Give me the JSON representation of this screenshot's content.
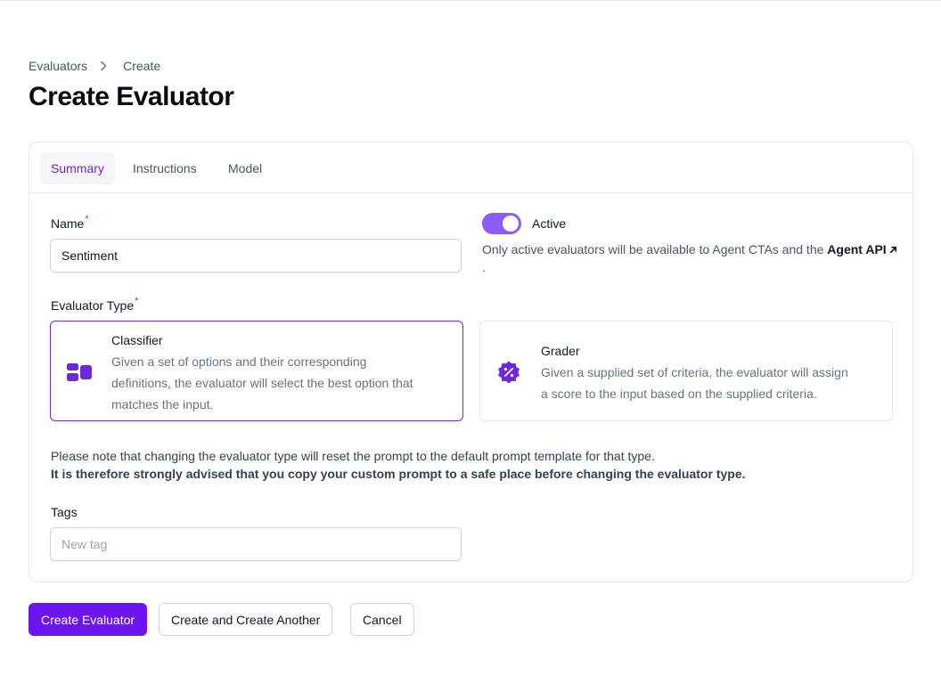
{
  "breadcrumb": {
    "items": [
      "Evaluators",
      "Create"
    ]
  },
  "page": {
    "title": "Create Evaluator"
  },
  "tabs": [
    {
      "label": "Summary",
      "active": true
    },
    {
      "label": "Instructions",
      "active": false
    },
    {
      "label": "Model",
      "active": false
    }
  ],
  "form": {
    "name_label": "Name",
    "name_value": "Sentiment",
    "required_mark": "*",
    "active": {
      "label": "Active",
      "on": true,
      "desc_prefix": "Only active evaluators will be available to Agent CTAs and the ",
      "desc_link": "Agent API",
      "desc_suffix": "."
    },
    "evaluator_type_label": "Evaluator Type",
    "types": [
      {
        "title": "Classifier",
        "desc_lines": [
          "Given a set of options and their corresponding",
          "definitions, the evaluator will select the best option that",
          "matches the input."
        ],
        "selected": true,
        "icon": "blocks-icon"
      },
      {
        "title": "Grader",
        "desc_lines": [
          "Given a supplied set of criteria, the evaluator will assign",
          "a score to the input based on the supplied criteria."
        ],
        "selected": false,
        "icon": "percent-badge-icon"
      }
    ],
    "note": "Please note that changing the evaluator type will reset the prompt to the default prompt template for that type.",
    "note_strong": "It is therefore strongly advised that you copy your custom prompt to a safe place before changing the evaluator type.",
    "tags_label": "Tags",
    "tags_placeholder": "New tag"
  },
  "actions": {
    "create": "Create Evaluator",
    "create_another": "Create and Create Another",
    "cancel": "Cancel"
  },
  "colors": {
    "accent": "#6d28d9",
    "primary_button": "#6d14f0",
    "toggle_on": "#8b5cf6",
    "required": "#dc2626"
  }
}
